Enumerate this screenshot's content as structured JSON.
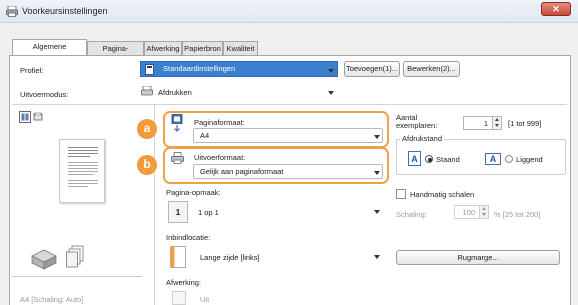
{
  "window": {
    "title": "Voorkeursinstellingen",
    "close_glyph": "✕"
  },
  "tabs": [
    {
      "label": "Algemene instellingen",
      "active": true
    },
    {
      "label": "Pagina-instelling",
      "active": false
    },
    {
      "label": "Afwerking",
      "active": false
    },
    {
      "label": "Papierbron",
      "active": false
    },
    {
      "label": "Kwaliteit",
      "active": false
    }
  ],
  "profile": {
    "label": "Profiel:",
    "value": "Standaardinstellingen",
    "add_button": "Toevoegen(1)...",
    "edit_button": "Bewerken(2)..."
  },
  "output_mode": {
    "label": "Uitvoermodus:",
    "value": "Afdrukken"
  },
  "page_size": {
    "badge": "a",
    "label": "Paginaformaat:",
    "value": "A4"
  },
  "output_size": {
    "badge": "b",
    "label": "Uitvoerformaat:",
    "value": "Gelijk aan paginaformaat"
  },
  "copies": {
    "label_line1": "Aantal",
    "label_line2": "exemplaren:",
    "value": "1",
    "range": "[1 tot 999]"
  },
  "orientation": {
    "label": "Afdrukstand",
    "portrait_icon": "A",
    "portrait_label": "Staand",
    "landscape_icon": "A",
    "landscape_label": "Liggend",
    "selected": "Staand"
  },
  "page_layout": {
    "label": "Pagina-opmaak:",
    "icon_text": "1",
    "value": "1 op 1"
  },
  "manual_scaling": {
    "label": "Handmatig schalen",
    "checked": false
  },
  "scaling": {
    "label": "Schaling:",
    "value": "100",
    "range": "% [25 tot 200]"
  },
  "binding": {
    "label": "Inbindlocatie:",
    "value": "Lange zijde [links]",
    "gutter_button": "Rugmarge..."
  },
  "finishing": {
    "label": "Afwerking:",
    "value": "Uit"
  },
  "bottom_left_text": "A4 [Schaling: Auto]",
  "colors": {
    "accent_orange": "#f29a3c",
    "close_red": "#c74a36"
  }
}
